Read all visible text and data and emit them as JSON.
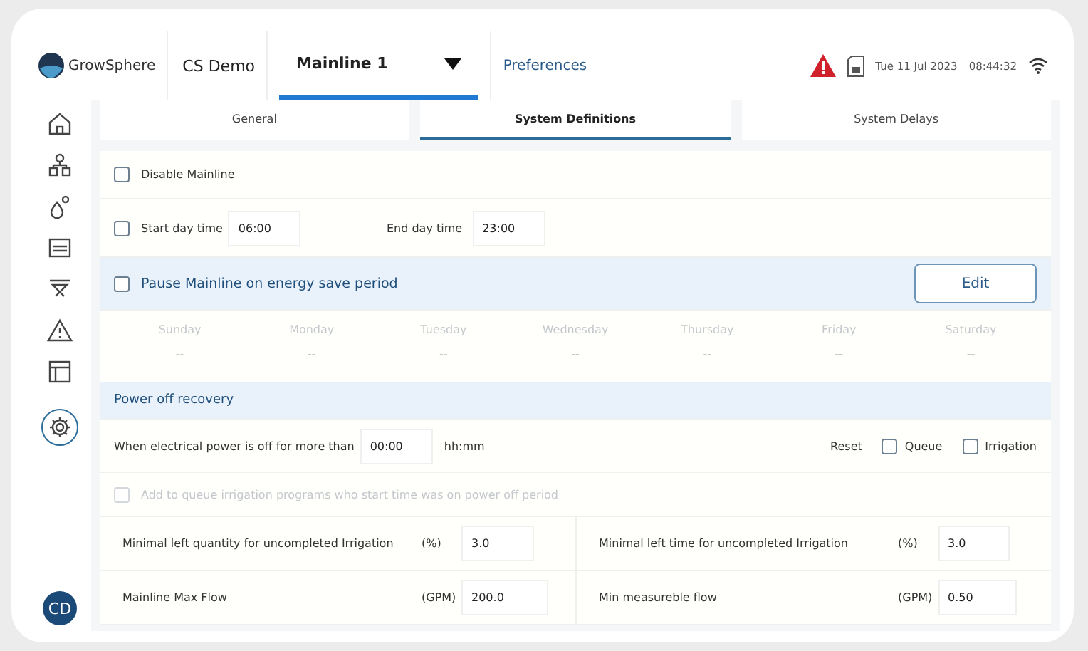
{
  "header": {
    "logo": "GrowSphere",
    "site": "CS Demo",
    "mainline": "Mainline 1",
    "preferences": "Preferences",
    "alert": true,
    "date": "Tue 11 Jul 2023",
    "time": "08:44:32"
  },
  "sidebar": {
    "items": [
      {
        "kind": "home",
        "selected": false
      },
      {
        "kind": "hierarchy",
        "selected": false
      },
      {
        "kind": "valve",
        "selected": false
      },
      {
        "kind": "board",
        "selected": false
      },
      {
        "kind": "filter",
        "selected": false
      },
      {
        "kind": "warning",
        "selected": false
      },
      {
        "kind": "table",
        "selected": false
      },
      {
        "kind": "gear",
        "selected": true
      }
    ],
    "avatar": "CD"
  },
  "tabs": [
    {
      "label": "General",
      "selected": false
    },
    {
      "label": "System Definitions",
      "selected": true
    },
    {
      "label": "System Delays",
      "selected": false
    }
  ],
  "disable_mainline": {
    "label": "Disable Mainline",
    "checked": false
  },
  "day_time": {
    "start_label": "Start day time",
    "start_checked": false,
    "start_value": "06:00",
    "end_label": "End day time",
    "end_value": "23:00"
  },
  "energy_save": {
    "label": "Pause Mainline on energy save period",
    "checked": false,
    "button": "Edit",
    "days": [
      {
        "name": "Sunday",
        "value": "--"
      },
      {
        "name": "Monday",
        "value": "--"
      },
      {
        "name": "Tuesday",
        "value": "--"
      },
      {
        "name": "Wednesday",
        "value": "--"
      },
      {
        "name": "Thursday",
        "value": "--"
      },
      {
        "name": "Friday",
        "value": "--"
      },
      {
        "name": "Saturday",
        "value": "--"
      }
    ]
  },
  "power_off": {
    "title": "Power off recovery",
    "label": "When electrical power is off for more than",
    "value": "00:00",
    "unit": "hh:mm",
    "reset": "Reset",
    "options": [
      {
        "label": "Queue",
        "checked": false
      },
      {
        "label": "Irrigation",
        "checked": false
      }
    ],
    "add_to_queue": {
      "label": "Add to queue irrigation programs who start time was on power off period",
      "checked": false,
      "disabled": true
    }
  },
  "params": [
    [
      {
        "label": "Minimal left quantity for uncompleted Irrigation",
        "unit": "(%)",
        "value": "3.0"
      },
      {
        "label": "Minimal left time for uncompleted Irrigation",
        "unit": "(%)",
        "value": "3.0"
      }
    ],
    [
      {
        "label": "Mainline Max Flow",
        "unit": "(GPM)",
        "value": "200.0"
      },
      {
        "label": "Min measureble flow",
        "unit": "(GPM)",
        "value": "0.50"
      }
    ]
  ]
}
